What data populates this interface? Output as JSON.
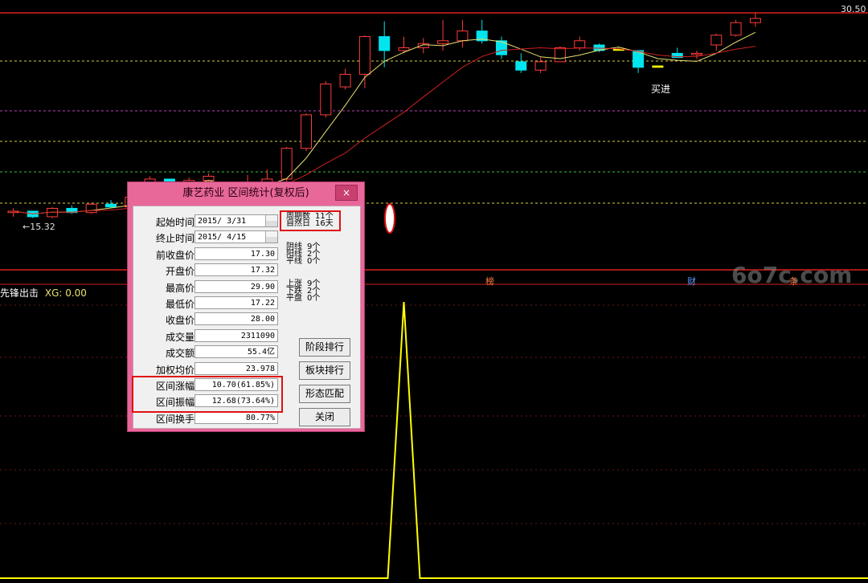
{
  "chart": {
    "max_label": "30.50",
    "min_label": "←15.32",
    "buy_label": "买进",
    "indicator_label": "先锋出击",
    "xg_label": "XG: 0.00",
    "event_marks": [
      "榜",
      "财",
      "条"
    ],
    "watermark": "6o7c.com",
    "colors": {
      "up": "#ff3b3b",
      "down": "#00e5ee",
      "signal": "#ffff00",
      "ma_short": "#e8e070",
      "ma_long": "#d02020"
    }
  },
  "chart_data": {
    "type": "candlestick",
    "candles": [
      [
        16.2,
        16.5,
        15.9,
        16.3
      ],
      [
        16.3,
        16.3,
        15.8,
        15.9
      ],
      [
        15.9,
        16.6,
        15.8,
        16.5
      ],
      [
        16.5,
        16.7,
        16.1,
        16.2
      ],
      [
        16.2,
        16.9,
        16.1,
        16.8
      ],
      [
        16.8,
        17.1,
        16.5,
        16.6
      ],
      [
        16.6,
        17.4,
        16.5,
        17.3
      ],
      [
        17.3,
        18.8,
        17.2,
        18.6
      ],
      [
        18.6,
        18.6,
        17.9,
        18.1
      ],
      [
        18.1,
        18.7,
        17.8,
        18.5
      ],
      [
        18.5,
        19.0,
        18.2,
        18.8
      ],
      [
        17.3,
        17.3,
        17.2,
        17.32
      ],
      [
        17.32,
        18.9,
        17.2,
        17.8
      ],
      [
        17.8,
        19.3,
        17.6,
        18.6
      ],
      [
        18.6,
        20.9,
        18.4,
        20.8
      ],
      [
        20.8,
        23.3,
        20.6,
        23.2
      ],
      [
        23.2,
        25.6,
        23.0,
        25.4
      ],
      [
        25.2,
        26.5,
        25.0,
        26.1
      ],
      [
        26.1,
        28.9,
        25.1,
        28.8
      ],
      [
        28.8,
        29.9,
        26.6,
        27.8
      ],
      [
        27.8,
        28.8,
        27.6,
        28.0
      ],
      [
        28.0,
        28.7,
        27.6,
        28.3
      ],
      [
        28.3,
        30.0,
        27.8,
        28.5
      ],
      [
        28.5,
        30.0,
        28.0,
        29.2
      ],
      [
        29.2,
        30.0,
        28.3,
        28.5
      ],
      [
        28.5,
        28.8,
        27.2,
        27.5
      ],
      [
        27.0,
        27.6,
        26.2,
        26.4
      ],
      [
        26.4,
        27.3,
        26.2,
        27.0
      ],
      [
        27.0,
        28.1,
        27.0,
        28.0
      ],
      [
        28.0,
        28.8,
        27.8,
        28.5
      ],
      [
        28.2,
        28.3,
        27.7,
        27.8
      ],
      [
        27.9,
        28.0,
        27.8,
        27.9
      ],
      [
        27.8,
        27.8,
        26.2,
        26.6
      ],
      [
        26.7,
        26.7,
        26.6,
        26.6
      ],
      [
        27.6,
        28.0,
        27.3,
        27.3
      ],
      [
        27.5,
        27.8,
        27.2,
        27.6
      ],
      [
        28.2,
        29.0,
        27.8,
        28.9
      ],
      [
        28.9,
        30.0,
        28.8,
        29.8
      ],
      [
        29.8,
        30.5,
        29.5,
        30.1
      ]
    ],
    "signal_candles": [
      11,
      31,
      33
    ],
    "buy_index": 31,
    "y_max": 30.5,
    "y_min": 15.32,
    "indicator": {
      "name": "XG",
      "value": 0.0,
      "pulse_index": 20
    }
  },
  "dialog": {
    "title": "康艺药业 区间统计(复权后)",
    "close": "×",
    "fields": [
      {
        "label": "起始时间",
        "value": "2015/ 3/31",
        "date": true
      },
      {
        "label": "终止时间",
        "value": "2015/ 4/15",
        "date": true
      },
      {
        "label": "前收盘价",
        "value": "17.30"
      },
      {
        "label": "开盘价",
        "value": "17.32"
      },
      {
        "label": "最高价",
        "value": "29.90"
      },
      {
        "label": "最低价",
        "value": "17.22"
      },
      {
        "label": "收盘价",
        "value": "28.00"
      },
      {
        "label": "成交量",
        "value": "2311090"
      },
      {
        "label": "成交额",
        "value": "55.4亿"
      },
      {
        "label": "加权均价",
        "value": "23.978"
      },
      {
        "label": "区间涨幅",
        "value": "10.70(61.85%)"
      },
      {
        "label": "区间振幅",
        "value": "12.68(73.64%)"
      },
      {
        "label": "区间换手",
        "value": "80.77%"
      }
    ],
    "stats": [
      {
        "label": "周期数",
        "value": "11个"
      },
      {
        "label": "自然日",
        "value": "16天"
      },
      {
        "label": "阴线",
        "value": "9个"
      },
      {
        "label": "阳线",
        "value": "2个"
      },
      {
        "label": "平线",
        "value": "0个"
      },
      {
        "label": "上涨",
        "value": "9个"
      },
      {
        "label": "下跌",
        "value": "2个"
      },
      {
        "label": "平盘",
        "value": "0个"
      }
    ],
    "buttons": [
      "阶段排行",
      "板块排行",
      "形态匹配",
      "关闭"
    ]
  }
}
